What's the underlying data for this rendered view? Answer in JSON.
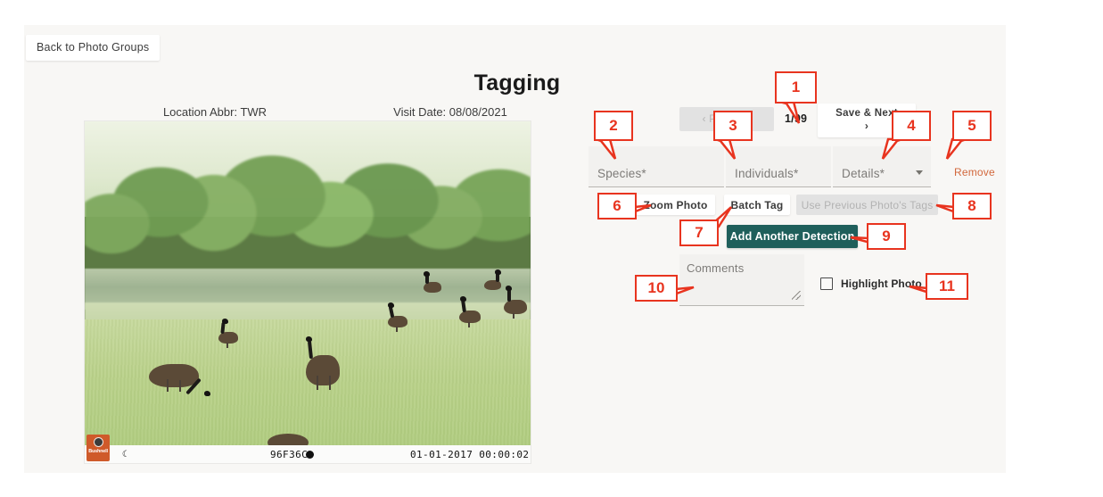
{
  "app": {
    "back_button": "Back to Photo Groups",
    "title": "Tagging"
  },
  "photo": {
    "location_label": "Location Abbr: TWR",
    "visit_date_label": "Visit Date: 08/08/2021",
    "camera_overlay": {
      "brand": "Bushnell",
      "moon_icon": "moon-phase-icon",
      "code": "96F36C",
      "marker_icon": "filled-circle-icon",
      "timestamp": "01-01-2017 00:00:02"
    },
    "scene_description": "Canada geese grazing on a lawn beside a pond with trees"
  },
  "navigation": {
    "previous_label": "‹ Previous",
    "previous_disabled": true,
    "counter": "1/99",
    "save_next_label": "Save & Next",
    "save_next_chevron": "›"
  },
  "form": {
    "species": {
      "placeholder": "Species*",
      "value": ""
    },
    "individuals": {
      "placeholder": "Individuals*",
      "value": ""
    },
    "details": {
      "placeholder": "Details*",
      "value": "",
      "caret_icon": "chevron-down-icon"
    },
    "remove_label": "Remove",
    "comments": {
      "placeholder": "Comments",
      "value": "",
      "grip_icon": "resize-grip-icon"
    },
    "highlight_photo": {
      "label": "Highlight Photo",
      "checked": false
    }
  },
  "actions": {
    "zoom_photo": "Zoom Photo",
    "batch_tag": "Batch Tag",
    "use_previous_tags": "Use Previous Photo's Tags",
    "use_previous_tags_disabled": true,
    "add_another_detection": "Add Another Detection"
  },
  "annotations": [
    {
      "id": "1",
      "label": "1",
      "target": "page-counter"
    },
    {
      "id": "2",
      "label": "2",
      "target": "species-field"
    },
    {
      "id": "3",
      "label": "3",
      "target": "individuals-field"
    },
    {
      "id": "4",
      "label": "4",
      "target": "details-field"
    },
    {
      "id": "5",
      "label": "5",
      "target": "remove-link"
    },
    {
      "id": "6",
      "label": "6",
      "target": "zoom-photo-button"
    },
    {
      "id": "7",
      "label": "7",
      "target": "batch-tag-button"
    },
    {
      "id": "8",
      "label": "8",
      "target": "use-previous-tags-button"
    },
    {
      "id": "9",
      "label": "9",
      "target": "add-another-detection-button"
    },
    {
      "id": "10",
      "label": "10",
      "target": "comments-textarea"
    },
    {
      "id": "11",
      "label": "11",
      "target": "highlight-photo-checkbox"
    }
  ],
  "colors": {
    "accent_teal": "#1f5f5b",
    "annotation_red": "#e8341f",
    "remove_orange": "#d2683c",
    "panel_bg": "#f8f7f5",
    "field_bg": "#f2f1ef",
    "disabled_gray": "#e2e2e2"
  }
}
